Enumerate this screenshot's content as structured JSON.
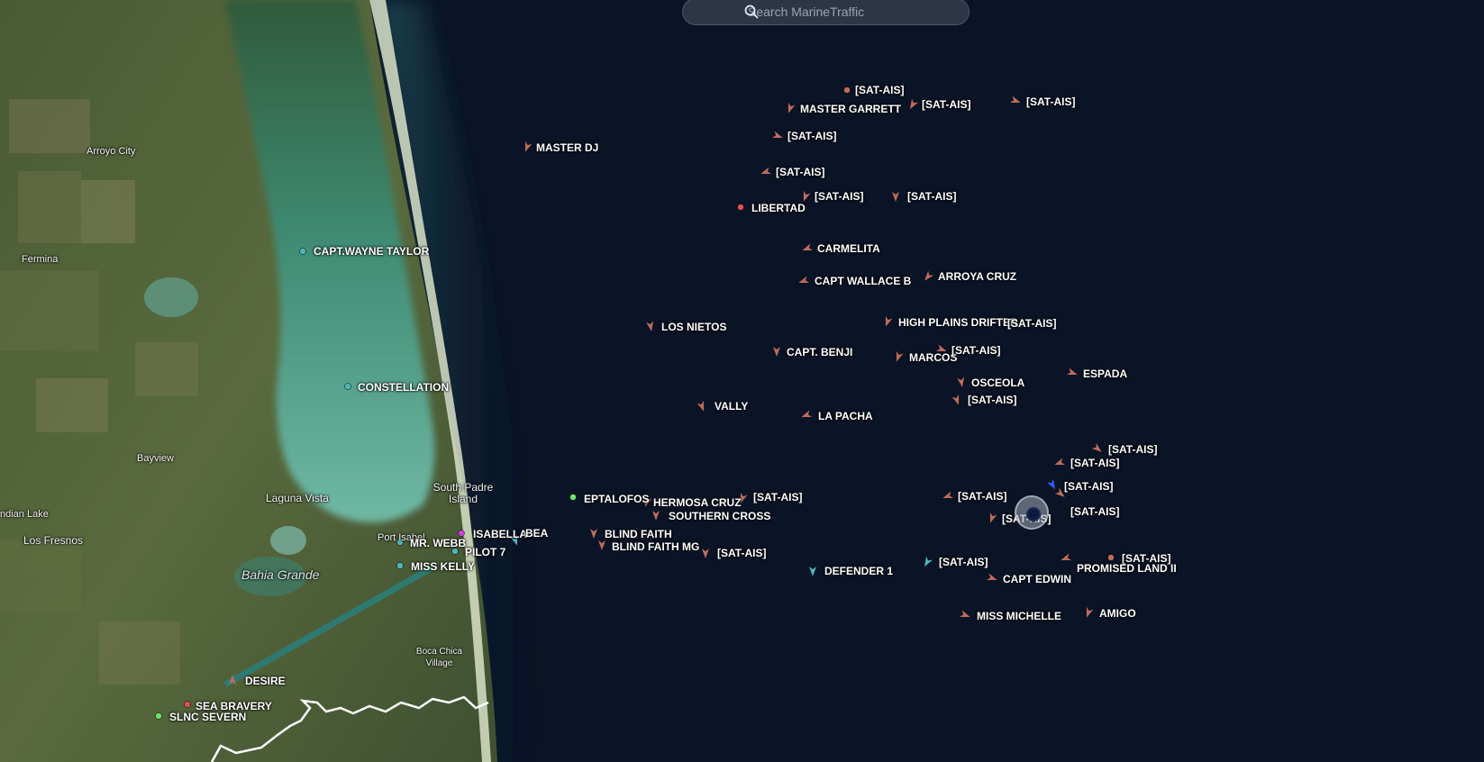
{
  "app": {
    "name": "MarineTraffic"
  },
  "search": {
    "placeholder": "Search MarineTraffic",
    "icon": "search-icon"
  },
  "colors": {
    "sea": "#0a1426",
    "vessel_default": "#c06b5a",
    "vessel_passenger": "#4fb6b8",
    "vessel_cargo": "#6ee36e",
    "vessel_selected": "#2f5bff",
    "vessel_special": "#d23ddb",
    "vessel_stationary": "#e05050"
  },
  "places": [
    {
      "name": "Arroyo City"
    },
    {
      "name": "Fermina"
    },
    {
      "name": "Bayview"
    },
    {
      "name": "Laguna Vista"
    },
    {
      "name": "South Padre Island"
    },
    {
      "name": "ndian Lake"
    },
    {
      "name": "Los Fresnos"
    },
    {
      "name": "Port Isabel"
    },
    {
      "name": "Bahia Grande"
    },
    {
      "name": "Boca Chica Village"
    }
  ],
  "vessels": [
    {
      "name": "[SAT-AIS]",
      "type": "default",
      "marker": "dot"
    },
    {
      "name": "MASTER GARRETT",
      "type": "default",
      "marker": "arrow"
    },
    {
      "name": "[SAT-AIS]",
      "type": "default",
      "marker": "arrow"
    },
    {
      "name": "[SAT-AIS]",
      "type": "default",
      "marker": "arrow"
    },
    {
      "name": "MASTER DJ",
      "type": "default",
      "marker": "arrow"
    },
    {
      "name": "[SAT-AIS]",
      "type": "default",
      "marker": "arrow"
    },
    {
      "name": "[SAT-AIS]",
      "type": "default",
      "marker": "arrow"
    },
    {
      "name": "[SAT-AIS]",
      "type": "default",
      "marker": "arrow"
    },
    {
      "name": "[SAT-AIS]",
      "type": "default",
      "marker": "arrow"
    },
    {
      "name": "LIBERTAD",
      "type": "stationary",
      "marker": "dot"
    },
    {
      "name": "CAPT.WAYNE TAYLOR",
      "type": "passenger",
      "marker": "dot"
    },
    {
      "name": "CARMELITA",
      "type": "default",
      "marker": "arrow"
    },
    {
      "name": "CAPT WALLACE B",
      "type": "default",
      "marker": "arrow"
    },
    {
      "name": "ARROYA CRUZ",
      "type": "default",
      "marker": "arrow"
    },
    {
      "name": "HIGH PLAINS DRIFTER",
      "type": "default",
      "marker": "arrow"
    },
    {
      "name": "[SAT-AIS]",
      "type": "default",
      "marker": "none"
    },
    {
      "name": "LOS NIETOS",
      "type": "default",
      "marker": "arrow"
    },
    {
      "name": "CAPT. BENJI",
      "type": "default",
      "marker": "arrow"
    },
    {
      "name": "MARCOS",
      "type": "default",
      "marker": "arrow"
    },
    {
      "name": "[SAT-AIS]",
      "type": "default",
      "marker": "arrow"
    },
    {
      "name": "CONSTELLATION",
      "type": "passenger",
      "marker": "dot"
    },
    {
      "name": "OSCEOLA",
      "type": "default",
      "marker": "arrow"
    },
    {
      "name": "ESPADA",
      "type": "default",
      "marker": "arrow"
    },
    {
      "name": "[SAT-AIS]",
      "type": "default",
      "marker": "arrow"
    },
    {
      "name": "VALLY",
      "type": "default",
      "marker": "arrow"
    },
    {
      "name": "LA PACHA",
      "type": "default",
      "marker": "arrow"
    },
    {
      "name": "[SAT-AIS]",
      "type": "default",
      "marker": "arrow"
    },
    {
      "name": "[SAT-AIS]",
      "type": "default",
      "marker": "arrow"
    },
    {
      "name": "[SAT-AIS]",
      "type": "selected",
      "marker": "arrow"
    },
    {
      "name": "EPTALOFOS",
      "type": "cargo",
      "marker": "dot"
    },
    {
      "name": "HERMOSA CRUZ",
      "type": "default",
      "marker": "arrow"
    },
    {
      "name": "[SAT-AIS]",
      "type": "default",
      "marker": "arrow"
    },
    {
      "name": "SOUTHERN CROSS",
      "type": "default",
      "marker": "arrow"
    },
    {
      "name": "[SAT-AIS]",
      "type": "default",
      "marker": "arrow"
    },
    {
      "name": "[SAT-AIS]",
      "type": "default",
      "marker": "arrow"
    },
    {
      "name": "[SAT-AIS]",
      "type": "default",
      "marker": "arrow"
    },
    {
      "name": "ISABELLA",
      "type": "special",
      "marker": "dot"
    },
    {
      "name": "BEA",
      "type": "passenger",
      "marker": "arrow"
    },
    {
      "name": "BLIND FAITH",
      "type": "default",
      "marker": "arrow"
    },
    {
      "name": "BLIND FAITH MG",
      "type": "default",
      "marker": "arrow"
    },
    {
      "name": "MR. WEBB",
      "type": "passenger",
      "marker": "dot"
    },
    {
      "name": "PILOT 7",
      "type": "passenger",
      "marker": "dot"
    },
    {
      "name": "[SAT-AIS]",
      "type": "default",
      "marker": "arrow"
    },
    {
      "name": "MISS KELLY",
      "type": "passenger",
      "marker": "dot"
    },
    {
      "name": "[SAT-AIS]",
      "type": "default",
      "marker": "dot"
    },
    {
      "name": "PROMISED LAND II",
      "type": "default",
      "marker": "arrow"
    },
    {
      "name": "DEFENDER 1",
      "type": "passenger",
      "marker": "arrow"
    },
    {
      "name": "[SAT-AIS]",
      "type": "passenger",
      "marker": "arrow"
    },
    {
      "name": "CAPT EDWIN",
      "type": "default",
      "marker": "arrow"
    },
    {
      "name": "MISS MICHELLE",
      "type": "default",
      "marker": "arrow"
    },
    {
      "name": "AMIGO",
      "type": "default",
      "marker": "arrow"
    },
    {
      "name": "DESIRE",
      "type": "default",
      "marker": "arrow"
    },
    {
      "name": "SEA BRAVERY",
      "type": "stationary",
      "marker": "dot"
    },
    {
      "name": "SLNC SEVERN",
      "type": "cargo",
      "marker": "dot"
    }
  ]
}
